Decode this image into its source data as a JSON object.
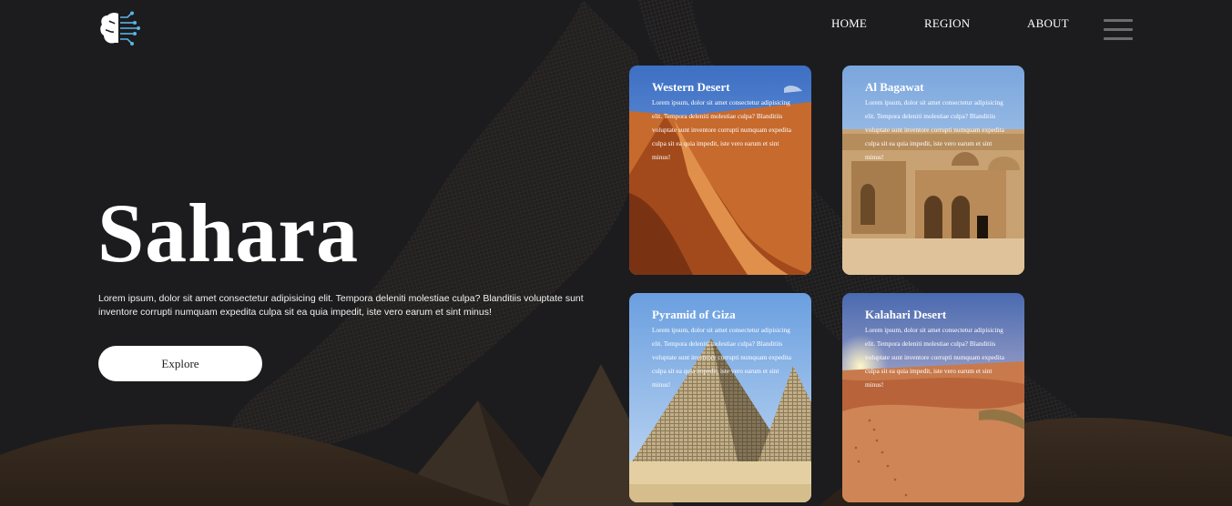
{
  "nav": {
    "items": [
      {
        "label": "HOME"
      },
      {
        "label": "REGION"
      },
      {
        "label": "ABOUT"
      }
    ]
  },
  "hero": {
    "title": "Sahara",
    "description": "Lorem ipsum, dolor sit amet consectetur adipisicing elit. Tempora deleniti molestiae culpa? Blanditiis voluptate sunt inventore corrupti numquam expedita culpa sit ea quia impedit, iste vero earum et sint minus!",
    "button_label": "Explore"
  },
  "cards": [
    {
      "title": "Western Desert",
      "text": "Lorem ipsum, dolor sit amet consectetur adipisicing elit. Tempora deleniti molestiae culpa? Blanditiis voluptate sunt inventore corrupti numquam expedita culpa sit ea quia impedit, iste vero earum et sint minus!"
    },
    {
      "title": "Al Bagawat",
      "text": "Lorem ipsum, dolor sit amet consectetur adipisicing elit. Tempora deleniti molestiae culpa? Blanditiis voluptate sunt inventore corrupti numquam expedita culpa sit ea quia impedit, iste vero earum et sint minus!"
    },
    {
      "title": "Pyramid of Giza",
      "text": "Lorem ipsum, dolor sit amet consectetur adipisicing elit. Tempora deleniti molestiae culpa? Blanditiis voluptate sunt inventore corrupti numquam expedita culpa sit ea quia impedit, iste vero earum et sint minus!"
    },
    {
      "title": "Kalahari Desert",
      "text": "Lorem ipsum, dolor sit amet consectetur adipisicing elit. Tempora deleniti molestiae culpa? Blanditiis voluptate sunt inventore corrupti numquam expedita culpa sit ea quia impedit, iste vero earum et sint minus!"
    }
  ],
  "icons": {
    "logo": "brain-circuit-icon",
    "menu": "hamburger-menu-icon"
  },
  "colors": {
    "background": "#1b1b1d",
    "button_bg": "#ffffff",
    "logo_accent": "#5ab4e6"
  }
}
